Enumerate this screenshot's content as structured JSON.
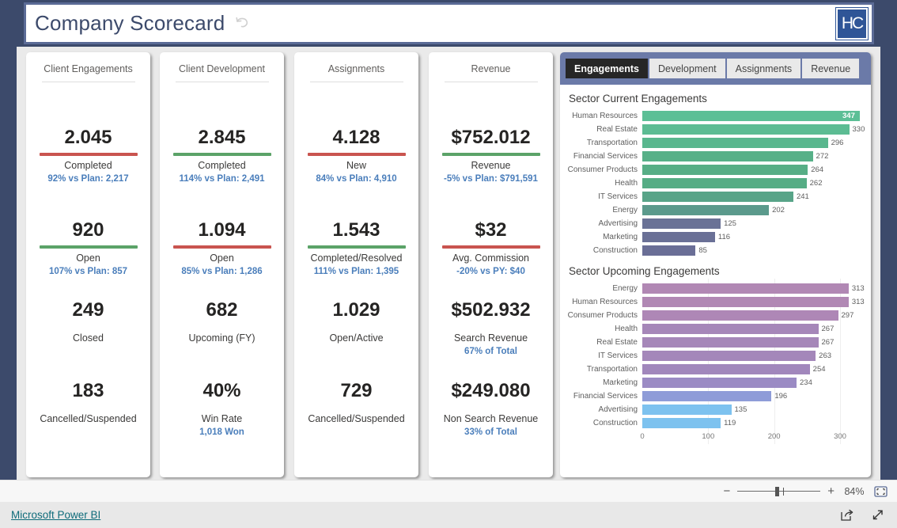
{
  "header": {
    "title": "Company Scorecard",
    "reset_icon": "undo-arrow-icon",
    "logo_text": "HC"
  },
  "cards": [
    {
      "title": "Client Engagements",
      "kpis": [
        {
          "value": "2.045",
          "bar": "#c9544f",
          "label": "Completed",
          "sub": "92% vs Plan: 2,217"
        },
        {
          "value": "920",
          "bar": "#5ba368",
          "label": "Open",
          "sub": "107% vs Plan: 857"
        },
        {
          "value": "249",
          "bar": "",
          "label": "Closed",
          "sub": ""
        },
        {
          "value": "183",
          "bar": "",
          "label": "Cancelled/Suspended",
          "sub": ""
        }
      ]
    },
    {
      "title": "Client Development",
      "kpis": [
        {
          "value": "2.845",
          "bar": "#5ba368",
          "label": "Completed",
          "sub": "114% vs Plan: 2,491"
        },
        {
          "value": "1.094",
          "bar": "#c9544f",
          "label": "Open",
          "sub": "85% vs Plan: 1,286"
        },
        {
          "value": "682",
          "bar": "",
          "label": "Upcoming (FY)",
          "sub": ""
        },
        {
          "value": "40%",
          "bar": "",
          "label": "Win Rate",
          "sub": "1,018 Won"
        }
      ]
    },
    {
      "title": "Assignments",
      "kpis": [
        {
          "value": "4.128",
          "bar": "#c9544f",
          "label": "New",
          "sub": "84% vs Plan: 4,910"
        },
        {
          "value": "1.543",
          "bar": "#5ba368",
          "label": "Completed/Resolved",
          "sub": "111% vs Plan: 1,395"
        },
        {
          "value": "1.029",
          "bar": "",
          "label": "Open/Active",
          "sub": ""
        },
        {
          "value": "729",
          "bar": "",
          "label": "Cancelled/Suspended",
          "sub": ""
        }
      ]
    },
    {
      "title": "Revenue",
      "kpis": [
        {
          "value": "$752.012",
          "bar": "#5ba368",
          "label": "Revenue",
          "sub": "-5% vs Plan: $791,591"
        },
        {
          "value": "$32",
          "bar": "#c9544f",
          "label": "Avg. Commission",
          "sub": "-20% vs PY: $40"
        },
        {
          "value": "$502.932",
          "bar": "",
          "label": "Search Revenue",
          "sub": "67% of Total"
        },
        {
          "value": "$249.080",
          "bar": "",
          "label": "Non Search Revenue",
          "sub": "33% of Total"
        }
      ]
    }
  ],
  "tabs": [
    {
      "label": "Engagements",
      "active": true
    },
    {
      "label": "Development",
      "active": false
    },
    {
      "label": "Assignments",
      "active": false
    },
    {
      "label": "Revenue",
      "active": false
    }
  ],
  "chart_data": [
    {
      "type": "bar",
      "orientation": "horizontal",
      "title": "Sector Current Engagements",
      "xlabel": "",
      "ylabel": "",
      "xlim": [
        0,
        347
      ],
      "grid": false,
      "axis_visible": false,
      "categories": [
        "Human Resources",
        "Real Estate",
        "Transportation",
        "Financial Services",
        "Consumer Products",
        "Health",
        "IT Services",
        "Energy",
        "Advertising",
        "Marketing",
        "Construction"
      ],
      "values": [
        347,
        330,
        296,
        272,
        264,
        262,
        241,
        202,
        125,
        116,
        85
      ],
      "colors": [
        "#5cbf96",
        "#5cbc93",
        "#59b78e",
        "#57b088",
        "#57ae86",
        "#56ad85",
        "#58a488",
        "#5b9a8c",
        "#6a7296",
        "#6a7096",
        "#6a6e96"
      ]
    },
    {
      "type": "bar",
      "orientation": "horizontal",
      "title": "Sector Upcoming Engagements",
      "xlabel": "",
      "ylabel": "",
      "xlim": [
        0,
        330
      ],
      "xticks": [
        0,
        100,
        200,
        300
      ],
      "grid": true,
      "axis_visible": true,
      "categories": [
        "Energy",
        "Human Resources",
        "Consumer Products",
        "Health",
        "Real Estate",
        "IT Services",
        "Transportation",
        "Marketing",
        "Financial Services",
        "Advertising",
        "Construction"
      ],
      "values": [
        313,
        313,
        297,
        267,
        267,
        263,
        254,
        234,
        196,
        135,
        119
      ],
      "colors": [
        "#b188b4",
        "#b188b4",
        "#ae87b6",
        "#a687b9",
        "#a687b9",
        "#a487ba",
        "#a187bc",
        "#9b8bc4",
        "#8e9cd8",
        "#7dc2ef",
        "#7dc2ef"
      ]
    }
  ],
  "statusbar": {
    "zoom_minus": "−",
    "zoom_plus": "+",
    "zoom_percent": "84%",
    "fit_icon": "fit-to-page-icon"
  },
  "footer": {
    "link": "Microsoft Power BI",
    "share_icon": "share-export-icon",
    "fullscreen_icon": "fullscreen-arrows-icon"
  }
}
